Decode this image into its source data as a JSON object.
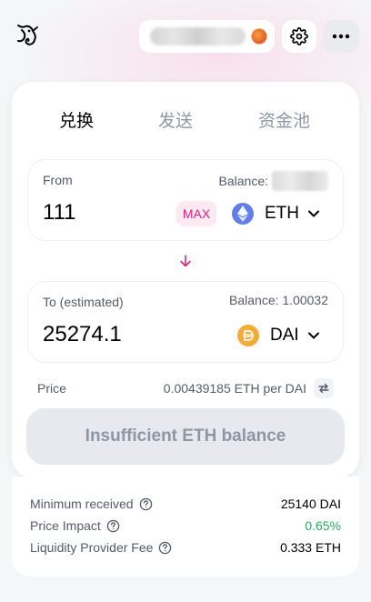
{
  "header": {
    "logo_icon": "unicorn-logo-icon",
    "settings_icon": "gear-icon",
    "more_icon": "more-horizontal-icon"
  },
  "tabs": [
    {
      "label": "兑换",
      "active": true
    },
    {
      "label": "发送",
      "active": false
    },
    {
      "label": "资金池",
      "active": false
    }
  ],
  "from_panel": {
    "label": "From",
    "balance_label": "Balance:",
    "amount": "111",
    "max_label": "MAX",
    "token": "ETH",
    "token_icon": "ethereum-icon"
  },
  "to_panel": {
    "label": "To (estimated)",
    "balance": "Balance: 1.00032",
    "amount": "25274.1",
    "token": "DAI",
    "token_icon": "dai-icon"
  },
  "price": {
    "label": "Price",
    "value": "0.00439185 ETH per DAI"
  },
  "main_button": {
    "label": "Insufficient ETH balance"
  },
  "details": [
    {
      "label": "Minimum received",
      "value": "25140 DAI",
      "status": "normal"
    },
    {
      "label": "Price Impact",
      "value": "0.65%",
      "status": "good"
    },
    {
      "label": "Liquidity Provider Fee",
      "value": "0.333 ETH",
      "status": "normal"
    }
  ],
  "colors": {
    "accent_pink": "#e8207d",
    "good_green": "#27ae60",
    "eth_blue": "#627eea",
    "dai_gold": "#f5ac37"
  }
}
